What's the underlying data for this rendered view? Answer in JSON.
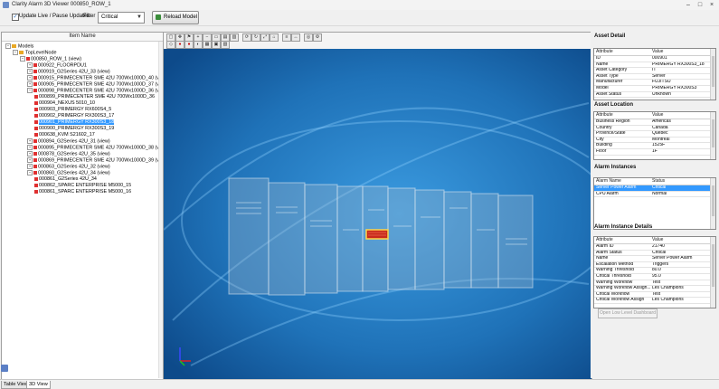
{
  "window": {
    "title": "Clarity Alarm 3D Viewer 000850_ROW_1"
  },
  "toolbar": {
    "update_label": "Update Live / Pause Updates",
    "update_checked": "✓",
    "filter_label": "Filter",
    "filter_value": "Critical",
    "reload_label": "Reload Model"
  },
  "tree": {
    "header": "Item Name",
    "rows": [
      {
        "depth": 0,
        "exp": "−",
        "label": "Models",
        "icon": "node"
      },
      {
        "depth": 1,
        "exp": "−",
        "label": "TopLevelNode",
        "icon": "node"
      },
      {
        "depth": 2,
        "exp": "−",
        "label": "000850_ROW_1 (view)",
        "icon": "flag"
      },
      {
        "depth": 3,
        "exp": "+",
        "label": "000922_FLOORPDU1",
        "icon": "flag"
      },
      {
        "depth": 3,
        "exp": "+",
        "label": "000919_G2Series 42U_33 (view)",
        "icon": "flag"
      },
      {
        "depth": 3,
        "exp": "+",
        "label": "000915_PRIMECENTER SME 42U 700Wx1000D_40 (view)",
        "icon": "flag"
      },
      {
        "depth": 3,
        "exp": "+",
        "label": "000905_PRIMECENTER SME 42U 700Wx1000D_37 (view)",
        "icon": "flag"
      },
      {
        "depth": 3,
        "exp": "−",
        "label": "000898_PRIMECENTER SME 42U 700Wx1000D_36 (view)",
        "icon": "flag"
      },
      {
        "depth": 4,
        "exp": "",
        "label": "000899_PRIMECENTER SME 42U 700Wx1000D_36",
        "icon": "flag"
      },
      {
        "depth": 4,
        "exp": "",
        "label": "000904_NEXUS 5010_10",
        "icon": "flag"
      },
      {
        "depth": 4,
        "exp": "",
        "label": "000903_PRIMERGY RX600S4_5",
        "icon": "flag"
      },
      {
        "depth": 4,
        "exp": "",
        "label": "000902_PRIMERGY RX300S3_17",
        "icon": "flag"
      },
      {
        "depth": 4,
        "exp": "",
        "label": "000901_PRIMERGY RX300S3_18",
        "icon": "flag",
        "sel": true
      },
      {
        "depth": 4,
        "exp": "",
        "label": "000900_PRIMERGY RX300S3_19",
        "icon": "flag"
      },
      {
        "depth": 4,
        "exp": "",
        "label": "000638_KVM S21602_17",
        "icon": "flag"
      },
      {
        "depth": 3,
        "exp": "+",
        "label": "000894_G2Series 42U_31 (view)",
        "icon": "flag"
      },
      {
        "depth": 3,
        "exp": "+",
        "label": "000895_PRIMECENTER SME 42U 700Wx1000D_38 (view)",
        "icon": "flag"
      },
      {
        "depth": 3,
        "exp": "+",
        "label": "000878_G2Series 42U_35 (view)",
        "icon": "flag"
      },
      {
        "depth": 3,
        "exp": "+",
        "label": "000869_PRIMECENTER SME 42U 700Wx1000D_39 (view)",
        "icon": "flag"
      },
      {
        "depth": 3,
        "exp": "+",
        "label": "000863_G2Series 42U_32 (view)",
        "icon": "flag"
      },
      {
        "depth": 3,
        "exp": "−",
        "label": "000860_G2Series 42U_34 (view)",
        "icon": "flag"
      },
      {
        "depth": 4,
        "exp": "",
        "label": "000861_G2Series 42U_34",
        "icon": "flag"
      },
      {
        "depth": 4,
        "exp": "",
        "label": "000862_SPARC ENTERPRISE M5000_15",
        "icon": "flag"
      },
      {
        "depth": 4,
        "exp": "",
        "label": "000861_SPARC ENTERPRISE M5000_16",
        "icon": "flag"
      }
    ]
  },
  "asset_detail": {
    "title": "Asset Detail",
    "columns": [
      "Attribute",
      "Value"
    ],
    "rows": [
      [
        "ID",
        "000901"
      ],
      [
        "Name",
        "PRIMERGY RX300S3_18"
      ],
      [
        "Asset Category",
        "IT"
      ],
      [
        "Asset Type",
        "Server"
      ],
      [
        "Manufacturer",
        "FUJITSU"
      ],
      [
        "Model",
        "PRIMERGY RX300S3"
      ],
      [
        "Asset Status",
        "Unknown"
      ]
    ]
  },
  "asset_location": {
    "title": "Asset Location",
    "columns": [
      "Attribute",
      "Value"
    ],
    "rows": [
      [
        "Business Region",
        "Americas"
      ],
      [
        "Country",
        "Canada"
      ],
      [
        "Province/State",
        "Quebec"
      ],
      [
        "City",
        "Montreal"
      ],
      [
        "Building",
        "1525F"
      ],
      [
        "Floor",
        "1F"
      ]
    ]
  },
  "alarm_instances": {
    "title": "Alarm Instances",
    "columns": [
      "Alarm Name",
      "Status"
    ],
    "rows": [
      [
        "Server Power Alarm",
        "Critical"
      ],
      [
        "CPU Alarm",
        "Normal"
      ]
    ]
  },
  "alarm_details": {
    "title": "Alarm Instance Details",
    "columns": [
      "Attribute",
      "Value"
    ],
    "rows": [
      [
        "Alarm ID",
        "21740"
      ],
      [
        "Alarm Status",
        "Critical"
      ],
      [
        "Name",
        "Server Power Alarm"
      ],
      [
        "Escalation Method",
        "Triggers"
      ],
      [
        "Warning Threshold",
        "80.0"
      ],
      [
        "Critical Threshold",
        "95.0"
      ],
      [
        "Warning Workflow",
        "Test"
      ],
      [
        "Warning Workflow Assign...",
        "Les Champions"
      ],
      [
        "Critical Workflow",
        "Test"
      ],
      [
        "Critical Workflow Assign",
        "Les Champions"
      ]
    ]
  },
  "open_dashboard_label": "Open Low Level Dashboard",
  "tabs": [
    "Table View",
    "3D View"
  ],
  "colors": {
    "selection": "#3399ff",
    "alarm_critical": "#e03030",
    "scene_bg": "#1e6fb5"
  }
}
